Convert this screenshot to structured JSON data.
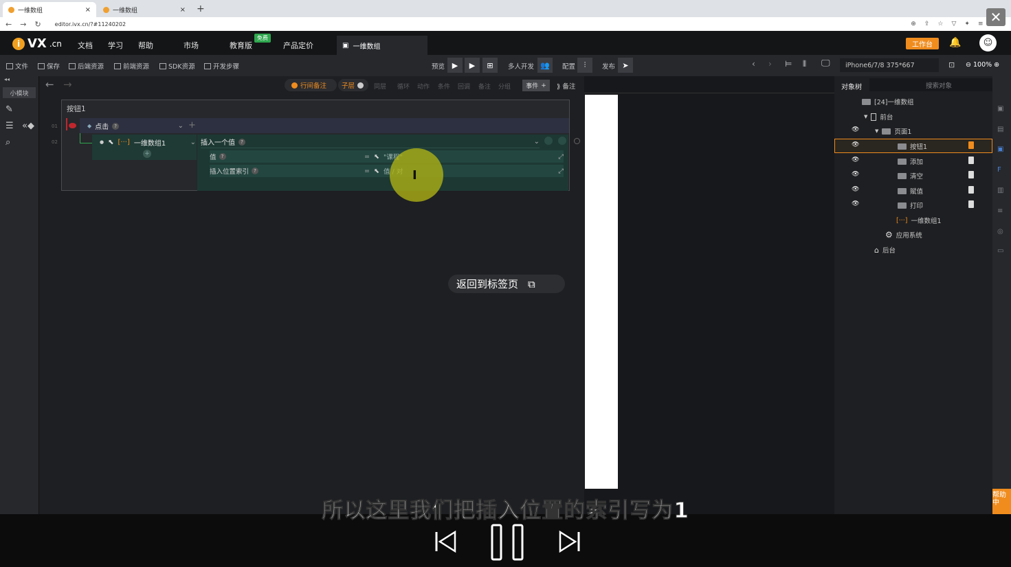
{
  "browser": {
    "tabs": [
      {
        "title": "一维数组",
        "close": "×"
      },
      {
        "title": "一维数组",
        "close": "×"
      }
    ],
    "new_tab": "+",
    "url": "editor.ivx.cn/?#11240202",
    "close_overlay": "✕"
  },
  "app": {
    "logo_letter": "i",
    "logo_name": "VX",
    "logo_suffix": ".cn",
    "nav": [
      "文档",
      "学习",
      "帮助",
      "市场",
      "教育版",
      "产品定价"
    ],
    "free_badge": "免费",
    "page_tab": "一维数组",
    "workbench": "工作台"
  },
  "toolbar": {
    "left": [
      "文件",
      "保存",
      "后端资源",
      "前端资源",
      "SDK资源",
      "开发步骤"
    ],
    "preview": "预览",
    "multi_dev": "多人开发",
    "config": "配置",
    "publish": "发布",
    "device": "iPhone6/7/8 375*667",
    "zoom": "100%"
  },
  "leftrail": {
    "small_module": "小模块"
  },
  "event_toolbar": {
    "row_note": "行间备注",
    "child_layer": "子层",
    "same_layer": "同层",
    "items": [
      "循环",
      "动作",
      "条件",
      "回调",
      "备注",
      "分组"
    ],
    "event": "事件",
    "memo": "备注"
  },
  "event_panel": {
    "title": "按钮1",
    "row_numbers": [
      "01",
      "02"
    ],
    "trigger": "点击",
    "target": "一维数组1",
    "action": "插入一个值",
    "params": [
      {
        "label": "值",
        "value": "\"课程\""
      },
      {
        "label": "插入位置索引",
        "value": "值 / 对"
      }
    ],
    "help": "?",
    "eq": "="
  },
  "return_pill": "返回到标签页",
  "object_tree": {
    "title": "对象树",
    "search_placeholder": "搜索对象",
    "nodes": [
      {
        "label": "[24]一维数组"
      },
      {
        "label": "前台"
      },
      {
        "label": "页面1"
      },
      {
        "label": "按钮1"
      },
      {
        "label": "添加"
      },
      {
        "label": "清空"
      },
      {
        "label": "赋值"
      },
      {
        "label": "打印"
      },
      {
        "label": "一维数组1"
      },
      {
        "label": "应用系统"
      },
      {
        "label": "后台"
      }
    ]
  },
  "help_tab": "帮助中",
  "video": {
    "subtitle": "所以这里我们把插入位置的索引写为1"
  },
  "colors": {
    "accent": "#f08c1e",
    "free": "#2fa84f"
  }
}
